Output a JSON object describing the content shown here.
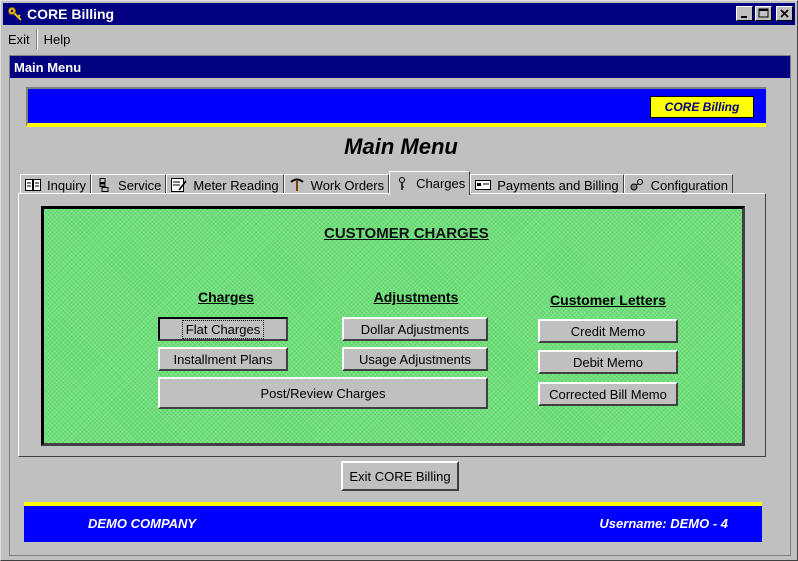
{
  "window": {
    "title": "CORE Billing"
  },
  "menu": {
    "items": [
      "Exit",
      "Help"
    ]
  },
  "child": {
    "title": "Main Menu",
    "brand_badge": "CORE Billing",
    "heading": "Main Menu"
  },
  "tabs": [
    {
      "label": "Inquiry",
      "icon": "inquiry-icon"
    },
    {
      "label": "Service",
      "icon": "service-icon"
    },
    {
      "label": "Meter Reading",
      "icon": "meter-reading-icon"
    },
    {
      "label": "Work Orders",
      "icon": "work-orders-icon"
    },
    {
      "label": "Charges",
      "icon": "charges-icon",
      "active": true
    },
    {
      "label": "Payments and Billing",
      "icon": "payments-icon"
    },
    {
      "label": "Configuration",
      "icon": "configuration-icon"
    }
  ],
  "panel": {
    "title": "CUSTOMER CHARGES",
    "charges": {
      "heading": "Charges",
      "flat_charges": "Flat Charges",
      "installment_plans": "Installment Plans",
      "post_review": "Post/Review Charges"
    },
    "adjustments": {
      "heading": "Adjustments",
      "dollar": "Dollar Adjustments",
      "usage": "Usage Adjustments"
    },
    "letters": {
      "heading": "Customer Letters",
      "credit_memo": "Credit Memo",
      "debit_memo": "Debit Memo",
      "corrected_bill_memo": "Corrected Bill Memo"
    }
  },
  "exit_button": "Exit CORE Billing",
  "footer": {
    "company": "DEMO COMPANY",
    "username": "Username: DEMO - 4"
  },
  "colors": {
    "titlebar": "#000080",
    "banner_blue": "#0000ff",
    "banner_yellow": "#ffff00",
    "panel_green": "#6de07a",
    "window_gray": "#c0c0c0"
  }
}
